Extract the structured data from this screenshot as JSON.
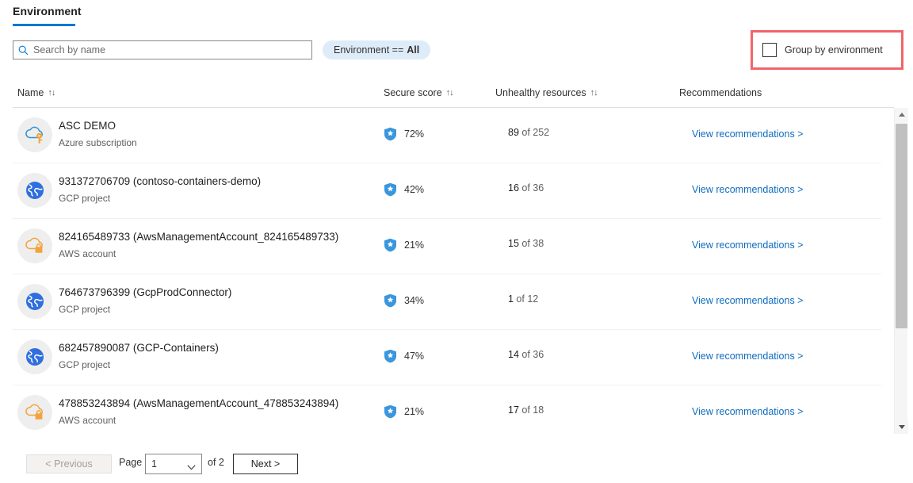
{
  "tabs": [
    {
      "label": "Environment",
      "active": true
    }
  ],
  "search": {
    "placeholder": "Search by name",
    "value": "",
    "icon": "search-icon"
  },
  "filter_pill": {
    "prefix": "Environment ==",
    "value": "All"
  },
  "group_by": {
    "label": "Group by environment",
    "checked": false,
    "highlighted": true,
    "highlight_color": "#f0656a"
  },
  "table": {
    "columns": [
      {
        "label": "Name",
        "sortable": true,
        "sort_glyph": "↑↓"
      },
      {
        "label": "Secure score",
        "sortable": true,
        "sort_glyph": "↑↓"
      },
      {
        "label": "Unhealthy resources",
        "sortable": true,
        "sort_glyph": "↑↓"
      },
      {
        "label": "Recommendations",
        "sortable": false,
        "sort_glyph": ""
      }
    ],
    "rows": [
      {
        "icon": "azure-cloud-key-icon",
        "name": "ASC DEMO",
        "type": "Azure subscription",
        "secure_score": "72%",
        "unhealthy_count": "89",
        "unhealthy_suffix": " of 252",
        "recommendations_link": "View recommendations >"
      },
      {
        "icon": "gcp-globe-icon",
        "name": "931372706709 (contoso-containers-demo)",
        "type": "GCP project",
        "secure_score": "42%",
        "unhealthy_count": "16",
        "unhealthy_suffix": " of 36",
        "recommendations_link": "View recommendations >"
      },
      {
        "icon": "aws-cloud-lock-icon",
        "name": "824165489733 (AwsManagementAccount_824165489733)",
        "type": "AWS account",
        "secure_score": "21%",
        "unhealthy_count": "15",
        "unhealthy_suffix": " of 38",
        "recommendations_link": "View recommendations >"
      },
      {
        "icon": "gcp-globe-icon",
        "name": "764673796399 (GcpProdConnector)",
        "type": "GCP project",
        "secure_score": "34%",
        "unhealthy_count": "1",
        "unhealthy_suffix": " of 12",
        "recommendations_link": "View recommendations >"
      },
      {
        "icon": "gcp-globe-icon",
        "name": "682457890087 (GCP-Containers)",
        "type": "GCP project",
        "secure_score": "47%",
        "unhealthy_count": "14",
        "unhealthy_suffix": " of 36",
        "recommendations_link": "View recommendations >"
      },
      {
        "icon": "aws-cloud-lock-icon",
        "name": "478853243894 (AwsManagementAccount_478853243894)",
        "type": "AWS account",
        "secure_score": "21%",
        "unhealthy_count": "17",
        "unhealthy_suffix": " of 18",
        "recommendations_link": "View recommendations >"
      }
    ]
  },
  "pagination": {
    "previous_label": "< Previous",
    "previous_disabled": true,
    "page_label": "Page",
    "current_page": "1",
    "of_label": "of 2",
    "next_label": "Next >"
  },
  "colors": {
    "accent": "#0078d4",
    "link": "#0f6cbd",
    "pill_bg": "#deecf9",
    "highlight": "#f0656a",
    "shield": "#3a96dd",
    "gcp": "#2f6fde",
    "aws": "#f2a33c"
  }
}
